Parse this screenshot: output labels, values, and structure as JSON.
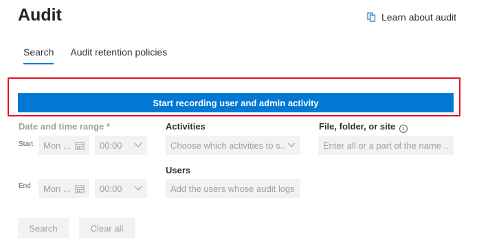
{
  "page": {
    "title": "Audit"
  },
  "learn_link": {
    "label": "Learn about audit",
    "icon": "document-copy-icon"
  },
  "tabs": [
    {
      "label": "Search",
      "active": true
    },
    {
      "label": "Audit retention policies",
      "active": false
    }
  ],
  "start_button": {
    "label": "Start recording user and admin activity"
  },
  "date_range": {
    "label": "Date and time range",
    "required_marker": "*",
    "start_label": "Start",
    "end_label": "End",
    "start_date": "Mon ...",
    "start_time": "00:00",
    "end_date": "Mon ...",
    "end_time": "00:00"
  },
  "activities": {
    "label": "Activities",
    "placeholder": "Choose which activities to s..."
  },
  "users": {
    "label": "Users",
    "placeholder": "Add the users whose audit logs y"
  },
  "file_folder": {
    "label": "File, folder, or site",
    "placeholder": "Enter all or a part of the name ..."
  },
  "actions": {
    "search_label": "Search",
    "clear_label": "Clear all"
  },
  "colors": {
    "accent": "#0078d4",
    "highlight": "#e81123",
    "disabled_bg": "#f3f2f1",
    "disabled_text": "#a19f9d"
  }
}
